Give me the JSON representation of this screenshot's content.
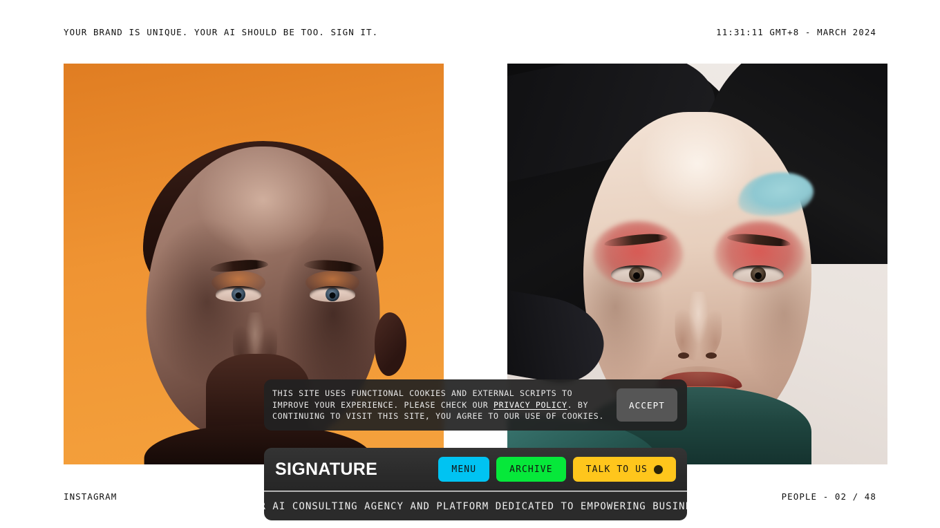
{
  "header": {
    "tagline": "YOUR BRAND IS UNIQUE. YOUR AI SHOULD BE TOO. SIGN IT.",
    "clock": "11:31:11 GMT+8 - MARCH 2024"
  },
  "gallery": {
    "left": {
      "alt": "portrait-orange-backdrop"
    },
    "right": {
      "alt": "portrait-blue-red-makeup"
    }
  },
  "footer": {
    "social_label": "INSTAGRAM",
    "counter": "PEOPLE - 02 / 48"
  },
  "cookie": {
    "text_before_link": "THIS SITE USES FUNCTIONAL COOKIES AND EXTERNAL SCRIPTS TO IMPROVE YOUR EXPERIENCE. PLEASE CHECK OUR ",
    "link_label": "PRIVACY POLICY",
    "text_after_link": ". BY CONTINUING TO VISIT THIS SITE, YOU AGREE TO OUR USE OF COOKIES.",
    "accept_label": "ACCEPT"
  },
  "dock": {
    "brand": "SIGNATURE",
    "buttons": [
      {
        "label": "MENU",
        "color": "#00c3f2",
        "has_dot": false
      },
      {
        "label": "ARCHIVE",
        "color": "#06e83a",
        "has_dot": false
      },
      {
        "label": "TALK TO US",
        "color": "#ffc61c",
        "has_dot": true
      }
    ]
  },
  "marquee": {
    "text": "ER AI CONSULTING AGENCY AND PLATFORM DEDICATED TO EMPOWERING BUSINE"
  }
}
